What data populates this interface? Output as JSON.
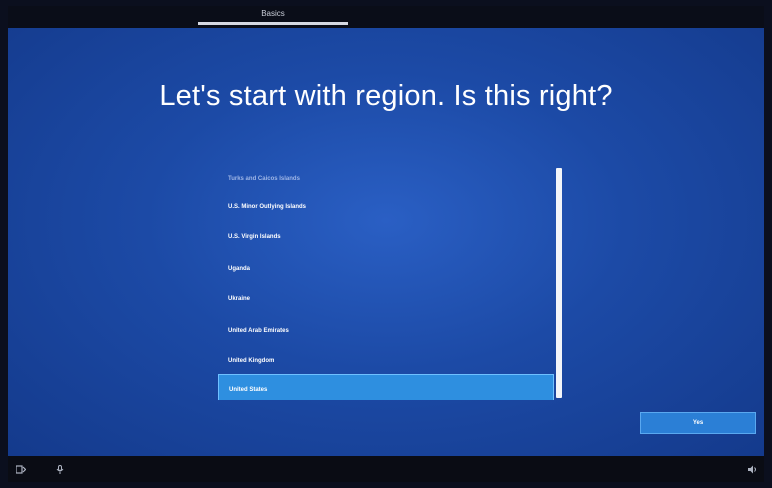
{
  "topbar": {
    "tab_label": "Basics",
    "progress_percent": 100
  },
  "page": {
    "title": "Let's start with region. Is this right?"
  },
  "region_list": {
    "items": [
      {
        "label": "Turks and Caicos Islands",
        "state": "faded"
      },
      {
        "label": "U.S. Minor Outlying Islands",
        "state": "normal"
      },
      {
        "label": "U.S. Virgin Islands",
        "state": "normal"
      },
      {
        "label": "Uganda",
        "state": "normal"
      },
      {
        "label": "Ukraine",
        "state": "normal"
      },
      {
        "label": "United Arab Emirates",
        "state": "normal"
      },
      {
        "label": "United Kingdom",
        "state": "normal"
      },
      {
        "label": "United States",
        "state": "selected"
      }
    ]
  },
  "buttons": {
    "next_label": "Yes"
  },
  "taskbar": {
    "icons": [
      "ease-of-access-icon",
      "microphone-icon",
      "volume-icon"
    ]
  },
  "colors": {
    "background": "#1c4aa6",
    "selected_item": "#2e8fe0",
    "button": "#2b7fd6",
    "text": "#ffffff"
  }
}
